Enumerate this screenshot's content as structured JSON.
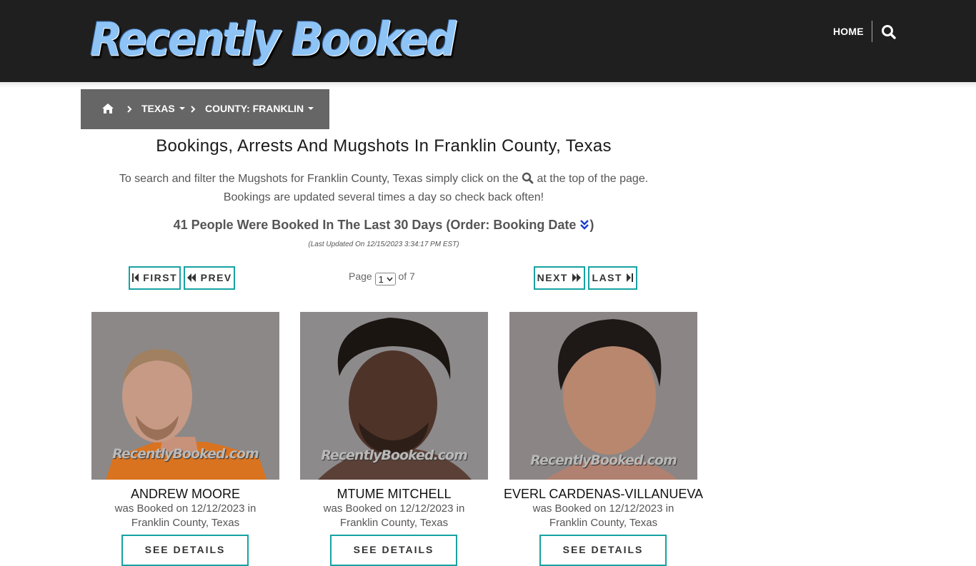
{
  "header": {
    "logo_text": "Recently Booked",
    "nav_home": "HOME",
    "search_icon": "search-icon"
  },
  "breadcrumb": {
    "home_icon": "home-icon",
    "state": "TEXAS",
    "county": "COUNTY: FRANKLIN"
  },
  "main": {
    "title": "Bookings, Arrests And Mugshots In Franklin County, Texas",
    "intro_before_icon": "To search and filter the Mugshots for Franklin County, Texas simply click on the",
    "intro_after_icon": "at the top of the page.",
    "intro_line2": "Bookings are updated several times a day so check back often!",
    "count_text": "41 People Were Booked In The Last 30 Days (Order: Booking Date",
    "count_close": ")",
    "last_updated": "(Last Updated On 12/15/2023 3:34:17 PM EST)"
  },
  "pagination": {
    "first": "FIRST",
    "prev": "PREV",
    "next": "NEXT",
    "last": "LAST",
    "page_label": "Page",
    "current_page": "1",
    "of_label": "of 7"
  },
  "cards": [
    {
      "name": "ANDREW MOORE",
      "booked_line1": "was Booked on 12/12/2023 in",
      "booked_line2": "Franklin County, Texas",
      "watermark": "RecentlyBooked.com",
      "button": "SEE DETAILS"
    },
    {
      "name": "MTUME MITCHELL",
      "booked_line1": "was Booked on 12/12/2023 in",
      "booked_line2": "Franklin County, Texas",
      "watermark": "RecentlyBooked.com",
      "button": "SEE DETAILS"
    },
    {
      "name": "EVERL CARDENAS-VILLANUEVA",
      "booked_line1": "was Booked on 12/12/2023 in",
      "booked_line2": "Franklin County, Texas",
      "watermark": "RecentlyBooked.com",
      "button": "SEE DETAILS"
    }
  ],
  "colors": {
    "header_bg": "#1f1f1f",
    "breadcrumb_bg": "#666666",
    "accent_teal": "#17a2a2",
    "logo_blue": "#8ec3f5",
    "order_icon_blue": "#1a3ccf"
  }
}
